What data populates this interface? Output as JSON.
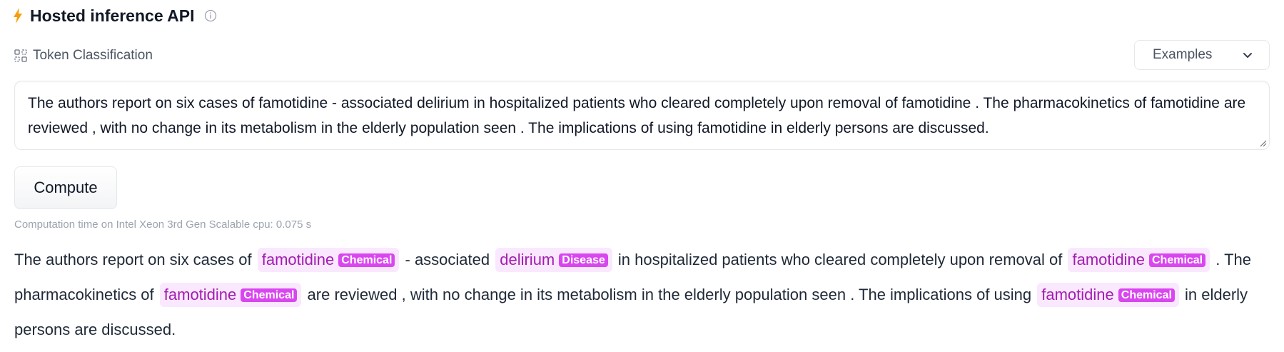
{
  "header": {
    "title": "Hosted inference API",
    "bolt_icon": "lightning-bolt-icon",
    "info_icon": "info-icon",
    "bolt_color": "#f59e0b"
  },
  "task": {
    "label": "Token Classification",
    "icon": "token-classification-icon"
  },
  "examples": {
    "label": "Examples"
  },
  "input": {
    "value": "The authors report on six cases of famotidine - associated delirium in hospitalized patients who cleared completely upon removal of famotidine . The pharmacokinetics of famotidine are reviewed , with no change in its metabolism in the elderly population seen . The implications of using famotidine in elderly persons are discussed."
  },
  "compute": {
    "label": "Compute"
  },
  "computation_time": "Computation time on Intel Xeon 3rd Gen Scalable cpu: 0.075 s",
  "result": {
    "entity_colors": {
      "bg": "#fae8ff",
      "text": "#a21caf",
      "tag": "#d946ef"
    },
    "segments": [
      {
        "text": "The authors report on six cases of "
      },
      {
        "entity": "famotidine",
        "label": "Chemical"
      },
      {
        "text": " - associated "
      },
      {
        "entity": "delirium",
        "label": "Disease"
      },
      {
        "text": " in hospitalized patients who cleared completely upon removal of "
      },
      {
        "entity": "famotidine",
        "label": "Chemical"
      },
      {
        "text": " . The pharmacokinetics of "
      },
      {
        "entity": "famotidine",
        "label": "Chemical"
      },
      {
        "text": " are reviewed , with no change in its metabolism in the elderly population seen . The implications of using "
      },
      {
        "entity": "famotidine",
        "label": "Chemical"
      },
      {
        "text": " in elderly persons are discussed."
      }
    ]
  }
}
